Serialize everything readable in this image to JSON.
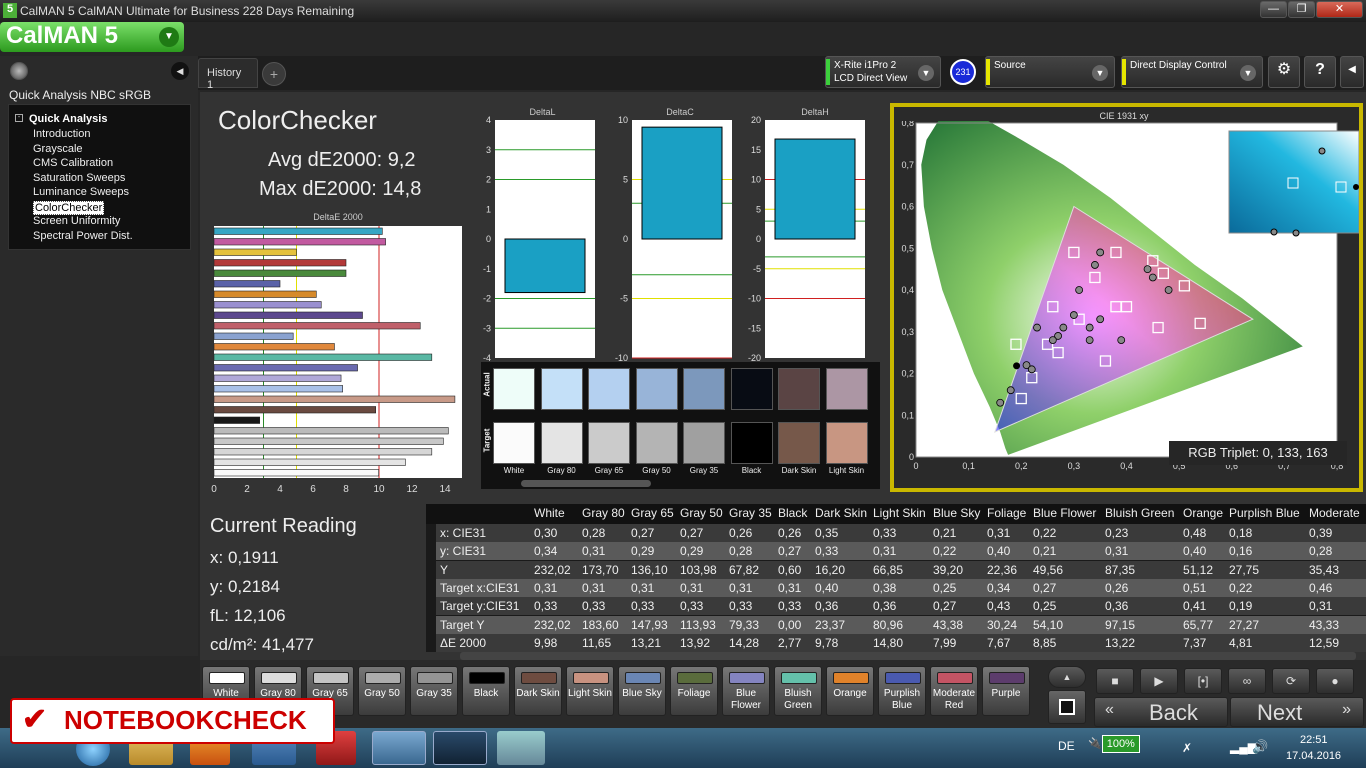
{
  "window": {
    "title": "CalMAN 5 CalMAN Ultimate for Business 228 Days Remaining",
    "minimize": "—",
    "maximize": "❐",
    "close": "✕"
  },
  "app": {
    "logo": "CalMAN 5"
  },
  "sidebar": {
    "title": "Quick Analysis NBC sRGB",
    "group": "Quick Analysis",
    "items": [
      "Introduction",
      "Grayscale",
      "CMS Calibration",
      "Saturation Sweeps",
      "Luminance Sweeps",
      "ColorChecker",
      "Screen Uniformity",
      "Spectral Power Dist."
    ],
    "selected_index": 5
  },
  "tabs": {
    "history": "History 1",
    "add": "+"
  },
  "toolbar": {
    "meter_line1": "X-Rite i1Pro 2",
    "meter_line2": "LCD Direct View",
    "meter_badge": "231",
    "source": "Source",
    "display": "Direct Display Control"
  },
  "colorchecker": {
    "title": "ColorChecker",
    "avg": "Avg dE2000: 9,2",
    "max": "Max dE2000: 14,8"
  },
  "deltae_chart": {
    "title": "DeltaE 2000",
    "ticks": [
      "0",
      "2",
      "4",
      "6",
      "8",
      "10",
      "12",
      "14"
    ],
    "values": [
      10.2,
      10.4,
      5.0,
      8.0,
      8.0,
      4.0,
      6.2,
      6.5,
      9.0,
      12.5,
      4.8,
      7.3,
      13.2,
      8.7,
      7.7,
      7.8,
      14.6,
      9.8,
      2.77,
      14.2,
      13.9,
      13.2,
      11.6,
      9.98
    ],
    "colors": [
      "#36a6c4",
      "#c25aa0",
      "#e4c23c",
      "#b23838",
      "#4a8a3c",
      "#5a62a8",
      "#d68a2a",
      "#9a90d0",
      "#5c488e",
      "#c0606a",
      "#8aa2d0",
      "#e0883c",
      "#5ab8a4",
      "#6a6ab0",
      "#b0a8d8",
      "#a8c0e8",
      "#c89a88",
      "#6a4a40",
      "#181818",
      "#bbbbbb",
      "#c8c8c8",
      "#d6d6d6",
      "#e4e4e4",
      "#fafafa"
    ]
  },
  "deltaL": {
    "title": "DeltaL",
    "ticks": [
      "4",
      "3",
      "2",
      "1",
      "0",
      "-1",
      "-2",
      "-3",
      "-4"
    ],
    "value": -1.8
  },
  "deltaC": {
    "title": "DeltaC",
    "ticks": [
      "10",
      "5",
      "0",
      "-5",
      "-10"
    ],
    "value": 9.4
  },
  "deltaH": {
    "title": "DeltaH",
    "ticks": [
      "20",
      "15",
      "10",
      "5",
      "0",
      "-5",
      "-10",
      "-15",
      "-20"
    ],
    "value": 16.8
  },
  "swatches": {
    "row_actual": "Actual",
    "row_target": "Target",
    "items": [
      {
        "name": "White",
        "actual": "#eefdf9",
        "target": "#fbfbfb"
      },
      {
        "name": "Gray 80",
        "actual": "#c4e0f8",
        "target": "#e4e4e4"
      },
      {
        "name": "Gray 65",
        "actual": "#b4d0f0",
        "target": "#cbcbcb"
      },
      {
        "name": "Gray 50",
        "actual": "#98b4d8",
        "target": "#b4b4b4"
      },
      {
        "name": "Gray 35",
        "actual": "#7c98bc",
        "target": "#a0a0a0"
      },
      {
        "name": "Black",
        "actual": "#080c14",
        "target": "#000000"
      },
      {
        "name": "Dark Skin",
        "actual": "#5a4444",
        "target": "#76584a"
      },
      {
        "name": "Light Skin",
        "actual": "#ac96a4",
        "target": "#c89682"
      }
    ]
  },
  "reading": {
    "title": "Current Reading",
    "x": "x: 0,1911",
    "y": "y: 0,2184",
    "fl": "fL: 12,106",
    "cdm2": "cd/m²: 41,477"
  },
  "table": {
    "columns": [
      "White",
      "Gray 80",
      "Gray 65",
      "Gray 50",
      "Gray 35",
      "Black",
      "Dark Skin",
      "Light Skin",
      "Blue Sky",
      "Foliage",
      "Blue Flower",
      "Bluish Green",
      "Orange",
      "Purplish Blue",
      "Moderate"
    ],
    "rows": [
      {
        "label": "x: CIE31",
        "values": [
          "0,30",
          "0,28",
          "0,27",
          "0,27",
          "0,26",
          "0,26",
          "0,35",
          "0,33",
          "0,21",
          "0,31",
          "0,22",
          "0,23",
          "0,48",
          "0,18",
          "0,39"
        ]
      },
      {
        "label": "y: CIE31",
        "values": [
          "0,34",
          "0,31",
          "0,29",
          "0,29",
          "0,28",
          "0,27",
          "0,33",
          "0,31",
          "0,22",
          "0,40",
          "0,21",
          "0,31",
          "0,40",
          "0,16",
          "0,28"
        ]
      },
      {
        "label": "Y",
        "values": [
          "232,02",
          "173,70",
          "136,10",
          "103,98",
          "67,82",
          "0,60",
          "16,20",
          "66,85",
          "39,20",
          "22,36",
          "49,56",
          "87,35",
          "51,12",
          "27,75",
          "35,43"
        ]
      },
      {
        "label": "Target x:CIE31",
        "values": [
          "0,31",
          "0,31",
          "0,31",
          "0,31",
          "0,31",
          "0,31",
          "0,40",
          "0,38",
          "0,25",
          "0,34",
          "0,27",
          "0,26",
          "0,51",
          "0,22",
          "0,46"
        ]
      },
      {
        "label": "Target y:CIE31",
        "values": [
          "0,33",
          "0,33",
          "0,33",
          "0,33",
          "0,33",
          "0,33",
          "0,36",
          "0,36",
          "0,27",
          "0,43",
          "0,25",
          "0,36",
          "0,41",
          "0,19",
          "0,31"
        ]
      },
      {
        "label": "Target Y",
        "values": [
          "232,02",
          "183,60",
          "147,93",
          "113,93",
          "79,33",
          "0,00",
          "23,37",
          "80,96",
          "43,38",
          "30,24",
          "54,10",
          "97,15",
          "65,77",
          "27,27",
          "43,33"
        ]
      },
      {
        "label": "ΔE 2000",
        "values": [
          "9,98",
          "11,65",
          "13,21",
          "13,92",
          "14,28",
          "2,77",
          "9,78",
          "14,80",
          "7,99",
          "7,67",
          "8,85",
          "13,22",
          "7,37",
          "4,81",
          "12,59"
        ]
      }
    ]
  },
  "cie": {
    "title": "CIE 1931 xy",
    "rgb_triplet": "RGB Triplet: 0, 133, 163",
    "xticks": [
      "0",
      "0,1",
      "0,2",
      "0,3",
      "0,4",
      "0,5",
      "0,6",
      "0,7",
      "0,8"
    ],
    "yticks": [
      "0,8",
      "0,7",
      "0,6",
      "0,5",
      "0,4",
      "0,3",
      "0,2",
      "0,1",
      "0"
    ],
    "targets": [
      [
        0.31,
        0.33
      ],
      [
        0.4,
        0.36
      ],
      [
        0.38,
        0.36
      ],
      [
        0.25,
        0.27
      ],
      [
        0.34,
        0.43
      ],
      [
        0.27,
        0.25
      ],
      [
        0.26,
        0.36
      ],
      [
        0.51,
        0.41
      ],
      [
        0.22,
        0.19
      ],
      [
        0.46,
        0.31
      ],
      [
        0.2,
        0.14
      ],
      [
        0.38,
        0.49
      ],
      [
        0.47,
        0.44
      ],
      [
        0.19,
        0.27
      ],
      [
        0.3,
        0.49
      ],
      [
        0.54,
        0.32
      ],
      [
        0.45,
        0.47
      ],
      [
        0.36,
        0.23
      ]
    ],
    "measured": [
      [
        0.3,
        0.34
      ],
      [
        0.28,
        0.31
      ],
      [
        0.27,
        0.29
      ],
      [
        0.26,
        0.28
      ],
      [
        0.35,
        0.33
      ],
      [
        0.33,
        0.31
      ],
      [
        0.21,
        0.22
      ],
      [
        0.31,
        0.4
      ],
      [
        0.22,
        0.21
      ],
      [
        0.23,
        0.31
      ],
      [
        0.48,
        0.4
      ],
      [
        0.18,
        0.16
      ],
      [
        0.39,
        0.28
      ],
      [
        0.16,
        0.13
      ],
      [
        0.34,
        0.46
      ],
      [
        0.45,
        0.43
      ],
      [
        0.35,
        0.49
      ],
      [
        0.44,
        0.45
      ],
      [
        0.33,
        0.28
      ]
    ]
  },
  "bottom_swatches": [
    {
      "label": "White",
      "color": "#ffffff"
    },
    {
      "label": "Gray 80",
      "color": "#dcdcdc"
    },
    {
      "label": "Gray 65",
      "color": "#c4c4c4"
    },
    {
      "label": "Gray 50",
      "color": "#acacac"
    },
    {
      "label": "Gray 35",
      "color": "#949494"
    },
    {
      "label": "Black",
      "color": "#000000"
    },
    {
      "label": "Dark Skin",
      "color": "#6e4c40"
    },
    {
      "label": "Light Skin",
      "color": "#c89280"
    },
    {
      "label": "Blue Sky",
      "color": "#6a86b4"
    },
    {
      "label": "Foliage",
      "color": "#5a6c3c"
    },
    {
      "label": "Blue Flower",
      "color": "#8484c0"
    },
    {
      "label": "Bluish Green",
      "color": "#64c0aa"
    },
    {
      "label": "Orange",
      "color": "#e0822a"
    },
    {
      "label": "Purplish Blue",
      "color": "#4a5ab0"
    },
    {
      "label": "Moderate Red",
      "color": "#c45464"
    },
    {
      "label": "Purple",
      "color": "#5c3c6c"
    }
  ],
  "nav": {
    "back": "Back",
    "next": "Next"
  },
  "taskbar": {
    "lang": "DE",
    "battery": "100%",
    "time": "22:51",
    "date": "17.04.2016"
  },
  "watermark": "NOTEBOOKCHECK"
}
